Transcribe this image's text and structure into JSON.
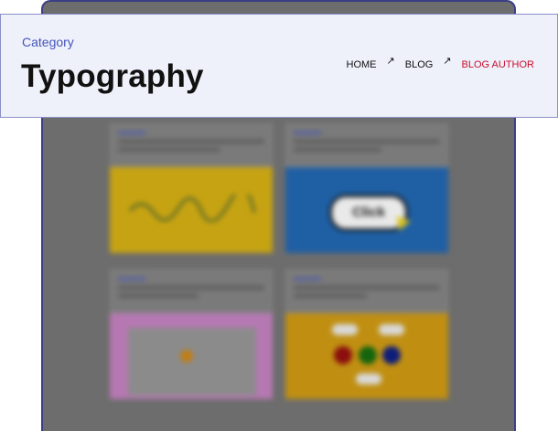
{
  "header": {
    "category": "Category",
    "title": "Typography"
  },
  "breadcrumb": {
    "items": [
      "HOME",
      "BLOG",
      "BLOG AUTHOR"
    ],
    "separator": "↗"
  },
  "background_grid": {
    "card_2_button_text": "Click"
  },
  "colors": {
    "accent": "#4457b8",
    "active_crumb": "#c8102e"
  }
}
